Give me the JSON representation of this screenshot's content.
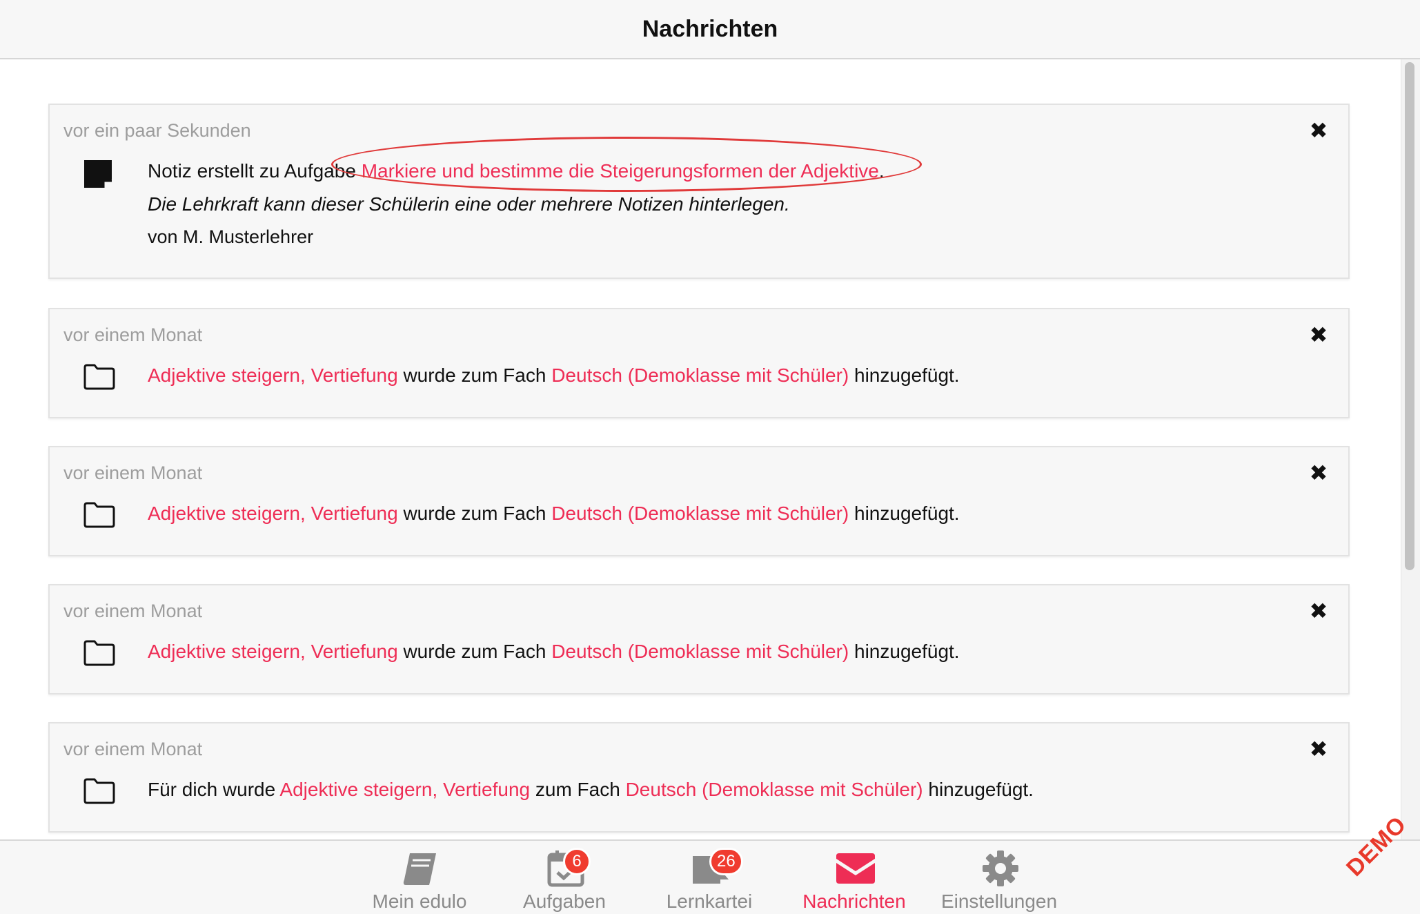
{
  "header": {
    "title": "Nachrichten"
  },
  "notifications": [
    {
      "time": "vor ein paar Sekunden",
      "icon": "note-icon",
      "line1_prefix": "Notiz erstellt zu Aufgabe ",
      "task_link": "Markiere und bestimme die Steigerungsformen der Adjektive",
      "line1_suffix": ".",
      "note_text": "Die Lehrkraft kann dieser Schülerin eine oder mehrere Notizen hinterlegen.",
      "author": "von M. Musterlehrer"
    },
    {
      "time": "vor einem Monat",
      "icon": "folder-icon",
      "topic_link": "Adjektive steigern, Vertiefung",
      "middle": " wurde zum Fach ",
      "subject_link": "Deutsch (Demoklasse mit Schüler)",
      "suffix": " hinzugefügt."
    },
    {
      "time": "vor einem Monat",
      "icon": "folder-icon",
      "topic_link": "Adjektive steigern, Vertiefung",
      "middle": " wurde zum Fach ",
      "subject_link": "Deutsch (Demoklasse mit Schüler)",
      "suffix": " hinzugefügt."
    },
    {
      "time": "vor einem Monat",
      "icon": "folder-icon",
      "topic_link": "Adjektive steigern, Vertiefung",
      "middle": " wurde zum Fach ",
      "subject_link": "Deutsch (Demoklasse mit Schüler)",
      "suffix": " hinzugefügt."
    },
    {
      "time": "vor einem Monat",
      "icon": "folder-icon",
      "prefix": "Für dich wurde ",
      "topic_link": "Adjektive steigern, Vertiefung",
      "middle": " zum Fach ",
      "subject_link": "Deutsch (Demoklasse mit Schüler)",
      "suffix": " hinzugefügt."
    }
  ],
  "close_symbol": "✖",
  "tabs": [
    {
      "label": "Mein edulo",
      "icon": "book-icon"
    },
    {
      "label": "Aufgaben",
      "icon": "calendar-check-icon",
      "badge": "6"
    },
    {
      "label": "Lernkartei",
      "icon": "flashcards-icon",
      "badge": "26"
    },
    {
      "label": "Nachrichten",
      "icon": "envelope-icon",
      "active": true
    },
    {
      "label": "Einstellungen",
      "icon": "gear-icon"
    }
  ],
  "demo_label": "DEMO",
  "colors": {
    "accent": "#ee2d55",
    "badge": "#f03c2f",
    "muted": "#9d9d9d",
    "annotation": "#e03a3a"
  }
}
